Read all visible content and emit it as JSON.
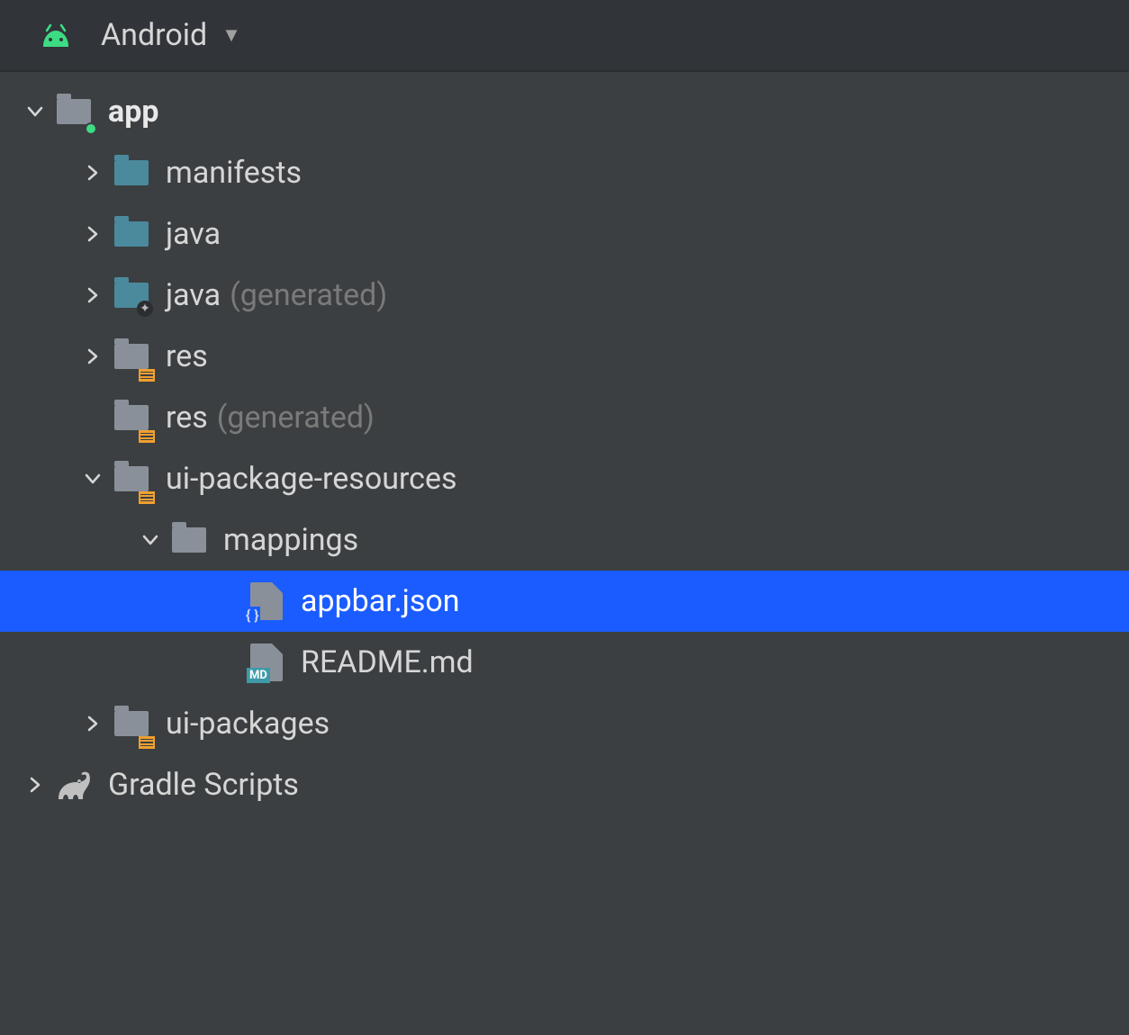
{
  "header": {
    "view_label": "Android"
  },
  "tree": {
    "app": {
      "label": "app",
      "children": {
        "manifests": {
          "label": "manifests"
        },
        "java": {
          "label": "java"
        },
        "java_generated": {
          "label": "java",
          "suffix": "(generated)"
        },
        "res": {
          "label": "res"
        },
        "res_generated": {
          "label": "res",
          "suffix": "(generated)"
        },
        "ui_package_resources": {
          "label": "ui-package-resources",
          "children": {
            "mappings": {
              "label": "mappings",
              "children": {
                "appbar_json": {
                  "label": "appbar.json"
                },
                "readme_md": {
                  "label": "README.md"
                }
              }
            }
          }
        },
        "ui_packages": {
          "label": "ui-packages"
        }
      }
    },
    "gradle_scripts": {
      "label": "Gradle Scripts"
    }
  }
}
